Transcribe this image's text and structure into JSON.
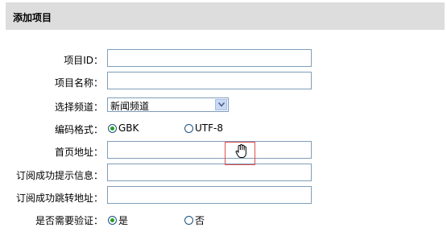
{
  "header": {
    "title": "添加项目"
  },
  "form": {
    "project_id": {
      "label": "项目ID：",
      "value": ""
    },
    "project_name": {
      "label": "项目名称：",
      "value": ""
    },
    "channel": {
      "label": "选择频道：",
      "selected": "新闻频道"
    },
    "encoding": {
      "label": "编码格式：",
      "options": [
        {
          "label": "GBK",
          "checked": true
        },
        {
          "label": "UTF-8",
          "checked": false
        }
      ]
    },
    "homepage": {
      "label": "首页地址：",
      "value": ""
    },
    "success_msg": {
      "label": "订阅成功提示信息：",
      "value": ""
    },
    "success_redirect": {
      "label": "订阅成功跳转地址：",
      "value": ""
    },
    "need_verify": {
      "label": "是否需要验证：",
      "options": [
        {
          "label": "是",
          "checked": true
        },
        {
          "label": "否",
          "checked": false
        }
      ]
    }
  },
  "cursor": {
    "icon": "hand-pointer-icon",
    "highlight_color": "#e05050"
  }
}
